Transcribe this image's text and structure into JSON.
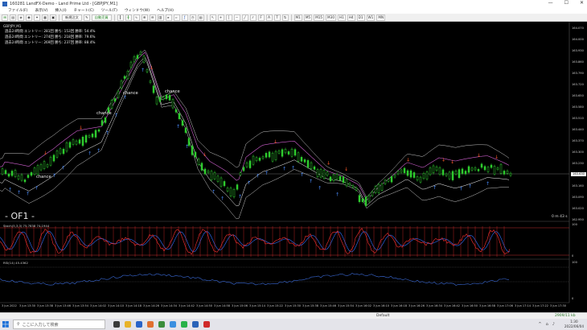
{
  "window": {
    "title": "160281 LandFX-Demo - Land Prime Ltd - [GBPJPY,M1]",
    "min": "—",
    "max": "☐",
    "close": "✕"
  },
  "menu": [
    "ファイル(F)",
    "表示(V)",
    "挿入(I)",
    "チャート(C)",
    "ツール(T)",
    "ウィンドウ(W)",
    "ヘルプ(H)"
  ],
  "toolbar": {
    "new_order": "新規注文",
    "auto_trade": "自動売買",
    "timeframes": [
      "M1",
      "M5",
      "M15",
      "M30",
      "H1",
      "H4",
      "D1",
      "W1",
      "MN"
    ]
  },
  "chart": {
    "symbol": "GBPJPY,M1",
    "stats": [
      "過去24時間  エントリー: 281回  勝ち: 153回  勝率: 54.4%",
      "過去24時間  エントリー: 274回  勝ち: 218回  勝率: 79.6%",
      "過去24時間  エントリー: 269回  勝ち: 237回  勝率: 88.4%"
    ],
    "main_label": "- OF1 -",
    "timer": "0 m 43 s",
    "current_price": "163.630",
    "price_ticks": [
      "164.070",
      "164.000",
      "163.930",
      "163.860",
      "163.790",
      "163.720",
      "163.650",
      "163.580",
      "163.510",
      "163.440",
      "163.370",
      "163.300",
      "163.230",
      "163.160",
      "163.090",
      "163.020",
      "162.950"
    ],
    "annotations": [
      "chance",
      "chance",
      "chance",
      "chance"
    ],
    "colors": {
      "bull": "#2ecc2e",
      "bear": "#2ecc2e",
      "up_arrow": "#4a8cff",
      "down_arrow": "#ff5a2a",
      "band_outer": "#c8c8c8",
      "band_mid": "#d060d0",
      "stoch_line": "#ff3030",
      "stoch_signal": "#3070ff"
    }
  },
  "stoch": {
    "label": "Stoch(5,3,3) 75.7838 74.1944",
    "ticks": [
      "100",
      "0"
    ]
  },
  "rsi": {
    "label": "RSI(14) 45.4362",
    "ticks": [
      "100",
      "0"
    ]
  },
  "time_axis": [
    "3 Jun 2022",
    "3 Jun 13:30",
    "3 Jun 13:38",
    "3 Jun 13:46",
    "3 Jun 13:54",
    "3 Jun 14:02",
    "3 Jun 14:10",
    "3 Jun 14:18",
    "3 Jun 14:26",
    "3 Jun 14:34",
    "3 Jun 14:42",
    "3 Jun 14:50",
    "3 Jun 14:58",
    "3 Jun 15:06",
    "3 Jun 15:14",
    "3 Jun 15:22",
    "3 Jun 15:30",
    "3 Jun 15:38",
    "3 Jun 15:46",
    "3 Jun 15:54",
    "3 Jun 16:02",
    "3 Jun 16:10",
    "3 Jun 16:18",
    "3 Jun 16:26",
    "3 Jun 16:34",
    "3 Jun 16:42",
    "3 Jun 16:50",
    "3 Jun 16:58",
    "3 Jun 17:06",
    "3 Jun 17:14",
    "3 Jun 17:22",
    "3 Jun 17:30",
    "3 Jun 17:38"
  ],
  "status": {
    "profile": "Default",
    "size": "2909/11 kb"
  },
  "taskbar": {
    "search_placeholder": "ここに入力して検索",
    "time": "1:30",
    "date": "2022/06/04"
  }
}
